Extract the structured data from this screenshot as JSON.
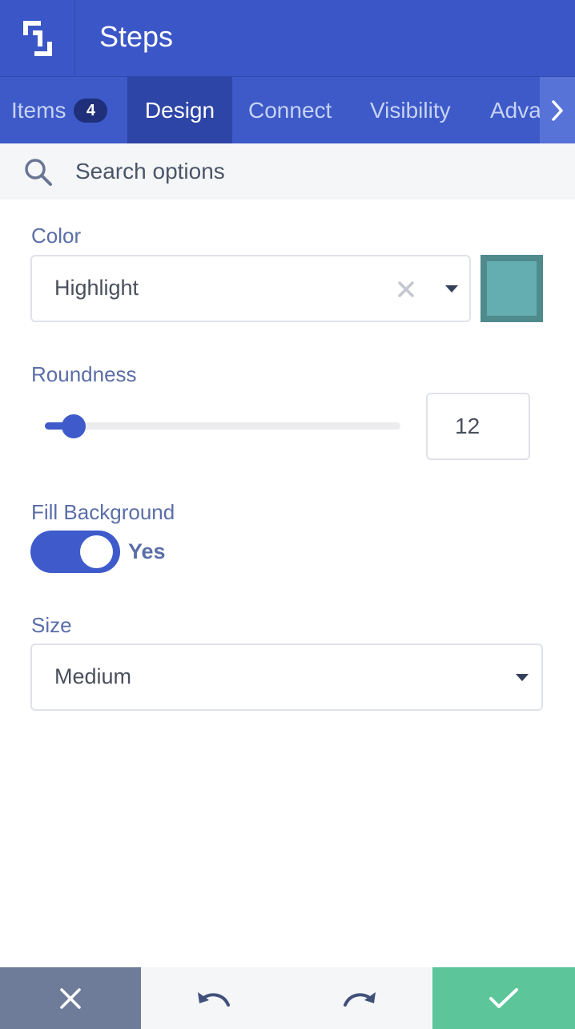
{
  "header": {
    "title": "Steps",
    "logo_icon": "frame-logo-icon"
  },
  "tabs": [
    {
      "label": "Items",
      "badge": "4"
    },
    {
      "label": "Design"
    },
    {
      "label": "Connect"
    },
    {
      "label": "Visibility"
    },
    {
      "label": "Adva"
    }
  ],
  "search": {
    "placeholder": "Search options"
  },
  "color_field": {
    "label": "Color",
    "value": "Highlight",
    "swatch_color": "#64adb1"
  },
  "roundness": {
    "label": "Roundness",
    "value": "12",
    "slider_fraction": 0.08
  },
  "fill_background": {
    "label": "Fill Background",
    "state_text": "Yes",
    "on": true
  },
  "size_field": {
    "label": "Size",
    "value": "Medium"
  },
  "footer": {
    "buttons": [
      "close-icon",
      "undo-icon",
      "redo-icon",
      "check-icon"
    ]
  },
  "colors": {
    "accent": "#3f5bcb",
    "header": "#3b56c6",
    "confirm": "#5cc59a",
    "cancel": "#6e7c9a"
  }
}
